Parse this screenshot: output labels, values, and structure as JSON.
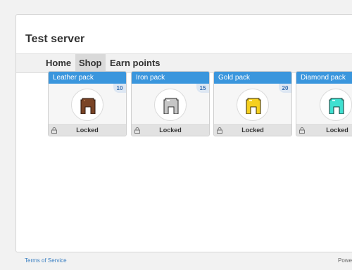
{
  "site": {
    "title": "Test server"
  },
  "nav": {
    "items": [
      {
        "label": "Home"
      },
      {
        "label": "Shop"
      },
      {
        "label": "Earn points"
      }
    ],
    "active_index": 1
  },
  "packs": [
    {
      "name": "Leather pack",
      "cost": "10",
      "status": "Locked",
      "icon": "leather-helmet-icon",
      "color": "#7a4426"
    },
    {
      "name": "Iron pack",
      "cost": "15",
      "status": "Locked",
      "icon": "iron-helmet-icon",
      "color": "#c6c6c6"
    },
    {
      "name": "Gold pack",
      "cost": "20",
      "status": "Locked",
      "icon": "gold-helmet-icon",
      "color": "#f5d020"
    },
    {
      "name": "Diamond pack",
      "cost": "",
      "status": "Locked",
      "icon": "diamond-helmet-icon",
      "color": "#3fe0d0"
    }
  ],
  "footer": {
    "terms": "Terms of Service",
    "powered": "Powe"
  },
  "colors": {
    "accent": "#3a96dd",
    "cost_text": "#3a6fb0"
  }
}
